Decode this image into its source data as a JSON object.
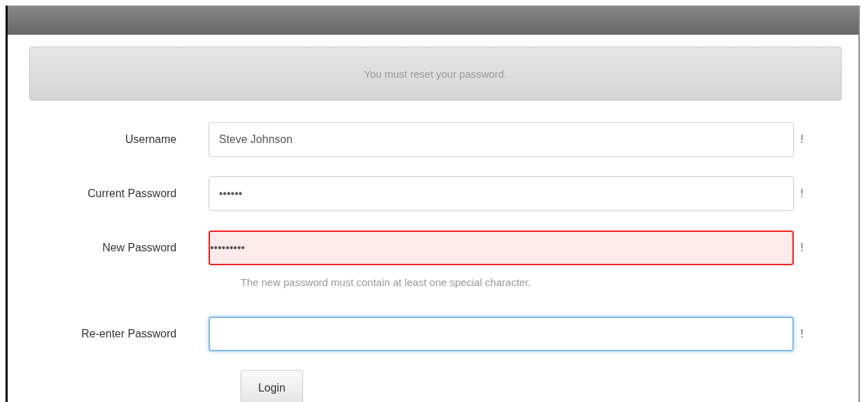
{
  "alert": {
    "message": "You must reset your password."
  },
  "fields": [
    {
      "label": "Username",
      "value": "Steve Johnson",
      "error": false,
      "focused": false,
      "marker": "!"
    },
    {
      "label": "Current Password",
      "value": "••••••",
      "error": false,
      "focused": false,
      "marker": "!"
    },
    {
      "label": "New Password",
      "value": "•••••••••",
      "error": true,
      "focused": false,
      "marker": "!",
      "hint": "The new password must contain at least one special character."
    },
    {
      "label": "Re-enter Password",
      "error": false,
      "focused": true,
      "marker": "!"
    }
  ],
  "buttons": [
    "Login"
  ]
}
